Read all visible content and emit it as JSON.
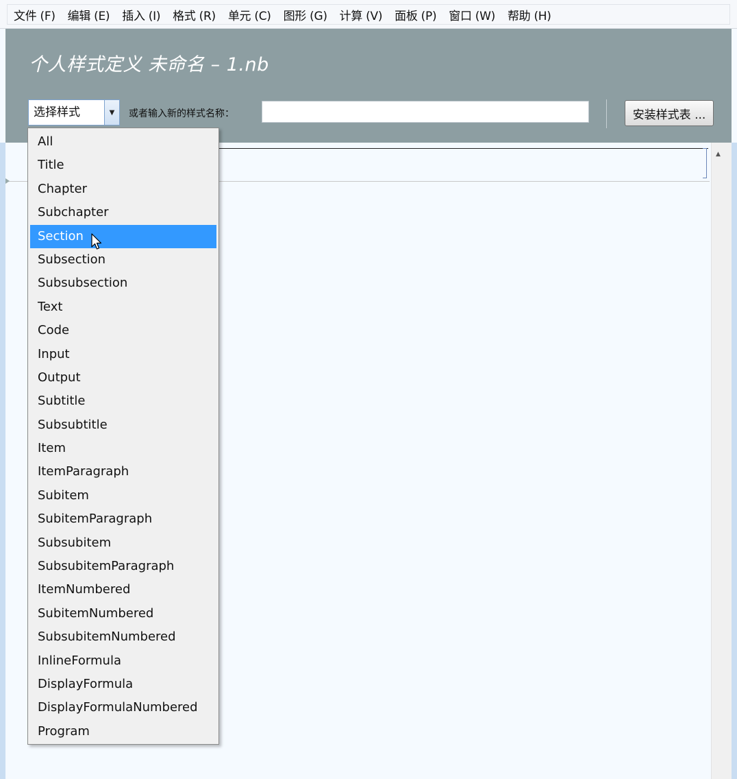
{
  "menubar": {
    "items": [
      "文件 (F)",
      "编辑 (E)",
      "插入 (I)",
      "格式 (R)",
      "单元 (C)",
      "图形 (G)",
      "计算 (V)",
      "面板 (P)",
      "窗口 (W)",
      "帮助 (H)"
    ]
  },
  "header": {
    "title": "个人样式定义 未命名 – 1.nb",
    "style_select_label": "选择样式",
    "name_label": "或者输入新的样式名称：",
    "name_input_value": "",
    "install_button_label": "安装样式表 ..."
  },
  "dropdown": {
    "selected": "Section",
    "items": [
      "All",
      "Title",
      "Chapter",
      "Subchapter",
      "Section",
      "Subsection",
      "Subsubsection",
      "Text",
      "Code",
      "Input",
      "Output",
      "Subtitle",
      "Subsubtitle",
      "Item",
      "ItemParagraph",
      "Subitem",
      "SubitemParagraph",
      "Subsubitem",
      "SubsubitemParagraph",
      "ItemNumbered",
      "SubitemNumbered",
      "SubsubitemNumbered",
      "InlineFormula",
      "DisplayFormula",
      "DisplayFormulaNumbered",
      "Program"
    ]
  },
  "colors": {
    "header_bg": "#8d9ea2",
    "selection": "#3399ff",
    "notebook_bg": "#f5faff"
  }
}
